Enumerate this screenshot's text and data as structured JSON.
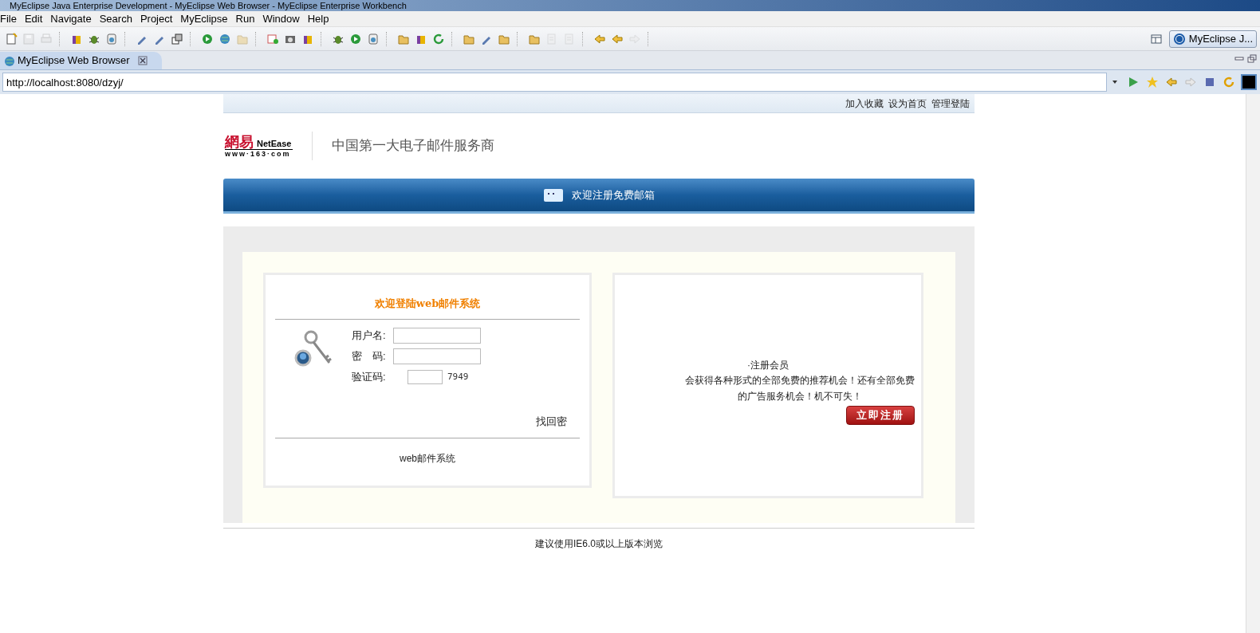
{
  "window": {
    "title": "MyEclipse Java Enterprise Development - MyEclipse Web Browser - MyEclipse Enterprise Workbench"
  },
  "menu": [
    "File",
    "Edit",
    "Navigate",
    "Search",
    "Project",
    "MyEclipse",
    "Run",
    "Window",
    "Help"
  ],
  "toolbar": [
    {
      "kind": "new",
      "disabled": false
    },
    {
      "kind": "save",
      "disabled": true
    },
    {
      "kind": "print",
      "disabled": true
    },
    {
      "kind": "box",
      "disabled": false
    },
    {
      "kind": "bug",
      "disabled": false
    },
    {
      "kind": "server",
      "disabled": false
    },
    {
      "kind": "pen",
      "disabled": false
    },
    {
      "kind": "pen",
      "disabled": false
    },
    {
      "kind": "deploy",
      "disabled": false
    },
    {
      "kind": "run",
      "disabled": false
    },
    {
      "kind": "globe",
      "disabled": false
    },
    {
      "kind": "folder",
      "disabled": true
    },
    {
      "kind": "export",
      "disabled": false
    },
    {
      "kind": "camera",
      "disabled": false
    },
    {
      "kind": "box",
      "disabled": false
    },
    {
      "kind": "bug",
      "disabled": false
    },
    {
      "kind": "run",
      "disabled": false
    },
    {
      "kind": "server",
      "disabled": false
    },
    {
      "kind": "folder",
      "disabled": false
    },
    {
      "kind": "box",
      "disabled": false
    },
    {
      "kind": "refresh",
      "disabled": false
    },
    {
      "kind": "folder",
      "disabled": false
    },
    {
      "kind": "pen",
      "disabled": false
    },
    {
      "kind": "folder",
      "disabled": false
    },
    {
      "kind": "folder",
      "disabled": false
    },
    {
      "kind": "next",
      "disabled": true
    },
    {
      "kind": "next",
      "disabled": true
    },
    {
      "kind": "back",
      "disabled": false
    },
    {
      "kind": "back",
      "disabled": false
    },
    {
      "kind": "forward",
      "disabled": true
    }
  ],
  "perspective": {
    "label": "MyEclipse J..."
  },
  "editor_tab": {
    "label": "MyEclipse Web Browser",
    "selected": true
  },
  "address": {
    "value": "http://localhost:8080/dzyj/"
  },
  "page": {
    "top_links": [
      "加入收藏",
      "设为首页",
      "管理登陆"
    ],
    "logo": {
      "brand": "網易",
      "brand_en": "NetEase",
      "site": "www·163·com"
    },
    "slogan": "中国第一大电子邮件服务商",
    "banner": "欢迎注册免费邮箱",
    "login": {
      "title": "欢迎登陆web邮件系统",
      "fields": [
        {
          "label": "用户名:",
          "kind": "text"
        },
        {
          "label": "密　码:",
          "kind": "password"
        },
        {
          "label": "验证码:",
          "kind": "captcha",
          "code": "7949"
        }
      ],
      "link": "找回密",
      "footer": "web邮件系统"
    },
    "register": {
      "heading": "·注册会员",
      "text": "会获得各种形式的全部免费的推荐机会！还有全部免费的广告服务机会！机不可失！",
      "button": "立即注册"
    },
    "footer": "建议使用IE6.0或以上版本浏览"
  }
}
